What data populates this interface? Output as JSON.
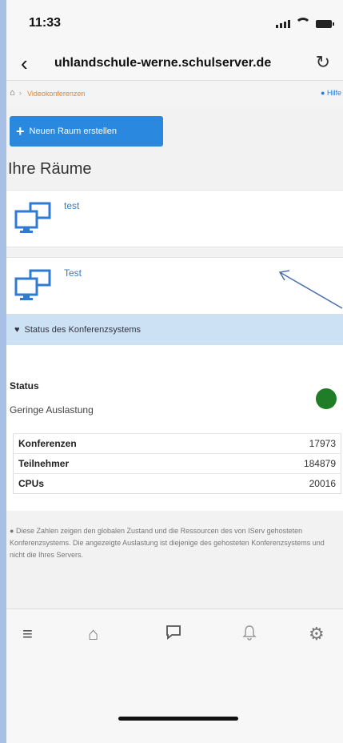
{
  "statusbar": {
    "time": "11:33"
  },
  "browser": {
    "url": "uhlandschule-werne.schulserver.de"
  },
  "breadcrumb": {
    "section": "Videokonferenzen",
    "help": "Hilfe"
  },
  "actions": {
    "new_room": "Neuen Raum erstellen"
  },
  "rooms": {
    "heading": "Ihre Räume",
    "items": [
      {
        "name": "test"
      },
      {
        "name": "Test"
      }
    ]
  },
  "conference_status": {
    "title": "Status des Konferenzsystems",
    "status_label": "Status",
    "status_value": "Geringe Auslastung",
    "status_color": "#1e7d26",
    "stats": [
      {
        "label": "Konferenzen",
        "value": "17973"
      },
      {
        "label": "Teilnehmer",
        "value": "184879"
      },
      {
        "label": "CPUs",
        "value": "20016"
      }
    ],
    "note": "Diese Zahlen zeigen den globalen Zustand und die Ressourcen des von IServ gehosteten Konferenzsystems. Die angezeigte Auslastung ist diejenige des gehosteten Konferenzsystems und nicht die Ihres Servers."
  },
  "tabbar": {
    "icons": [
      "menu-icon",
      "home-icon",
      "chat-icon",
      "bell-icon",
      "gear-icon"
    ]
  }
}
